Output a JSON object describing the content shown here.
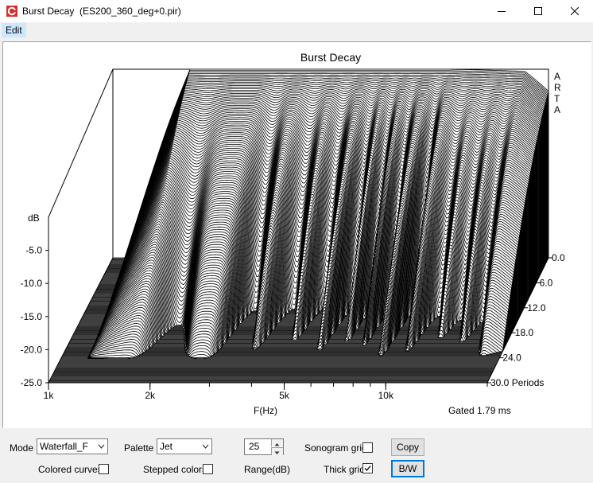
{
  "window": {
    "title": "Burst Decay  (ES200_360_deg+0.pir)"
  },
  "menu": {
    "items": [
      "Edit"
    ]
  },
  "chart_data": {
    "type": "waterfall",
    "title": "Burst Decay",
    "xlabel": "F(Hz)",
    "ylabel": "dB",
    "zlabel": "Periods",
    "watermark": "ARTA",
    "gating_note": "Gated 1.79 ms",
    "x_scale": "log",
    "xlim": [
      1000,
      20000
    ],
    "x_ticks": [
      {
        "value": 1000,
        "label": "1k"
      },
      {
        "value": 2000,
        "label": "2k"
      },
      {
        "value": 5000,
        "label": "5k"
      },
      {
        "value": 10000,
        "label": "10k"
      }
    ],
    "ylim": [
      -25,
      0
    ],
    "y_ticks": [
      -5,
      -10,
      -15,
      -20,
      -25
    ],
    "y_tick_labels": [
      "-5.0",
      "-10.0",
      "-15.0",
      "-20.0",
      "-25.0"
    ],
    "z_ticks": [
      0,
      6,
      12,
      18,
      24,
      30
    ],
    "z_tick_labels": [
      "0.0",
      "6.0",
      "12.0",
      "18.0",
      "24.0",
      "30.0 Periods"
    ],
    "z_lim": [
      0,
      30
    ],
    "line_color": "#000000",
    "background": "#ffffff"
  },
  "controls": {
    "mode": {
      "label": "Mode",
      "value": "Waterfall_F"
    },
    "palette": {
      "label": "Palette",
      "value": "Jet"
    },
    "range": {
      "value": "25",
      "label": "Range(dB)"
    },
    "sonogram_grid": {
      "label": "Sonogram grid",
      "checked": false
    },
    "colored_curves": {
      "label": "Colored curves",
      "checked": false
    },
    "stepped_colors": {
      "label": "Stepped colors",
      "checked": false
    },
    "thick_grid": {
      "label": "Thick grid",
      "checked": true
    },
    "copy_button": "Copy",
    "bw_button": "B/W"
  }
}
